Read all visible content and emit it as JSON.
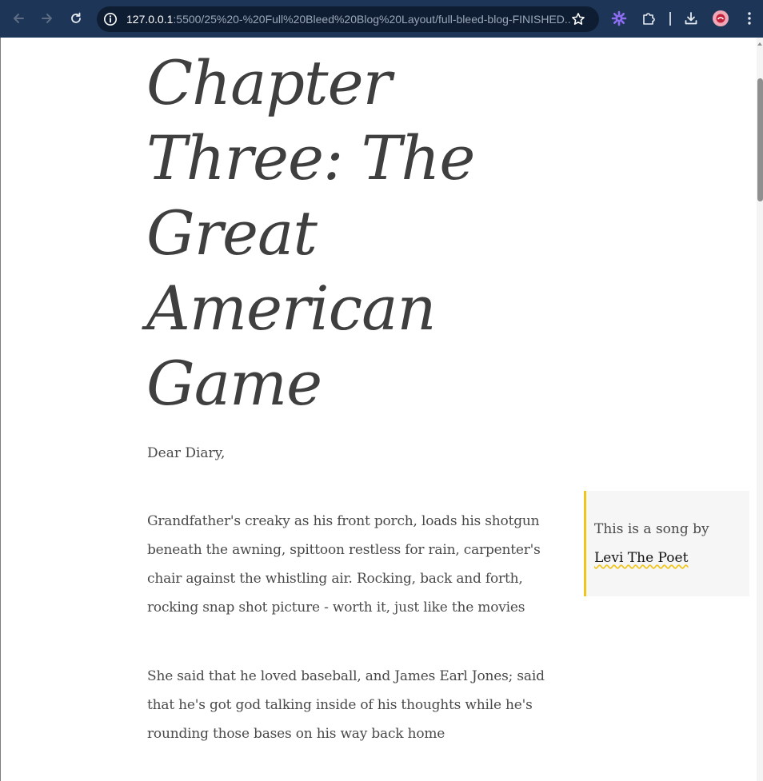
{
  "browser": {
    "url_host": "127.0.0.1",
    "url_rest": ":5500/25%20-%20Full%20Bleed%20Blog%20Layout/full-bleed-blog-FINISHED...",
    "colors": {
      "toolbar": "#1d3557",
      "omnibox": "#0f1d33"
    }
  },
  "article": {
    "title": "Chapter Three: The Great American Game",
    "salutation": "Dear Diary,",
    "paragraphs": [
      "Grandfather's creaky as his front porch, loads his shotgun beneath the awning, spittoon restless for rain, carpenter's chair against the whistling air. Rocking, back and forth, rocking snap shot picture - worth it, just like the movies",
      "She said that he loved baseball, and James Earl Jones; said that he's got god talking inside of his thoughts while he's rounding those bases on his way back home"
    ]
  },
  "aside": {
    "text": "This is a song by ",
    "link_text": "Levi The Poet",
    "accent_color": "#f0c419"
  }
}
